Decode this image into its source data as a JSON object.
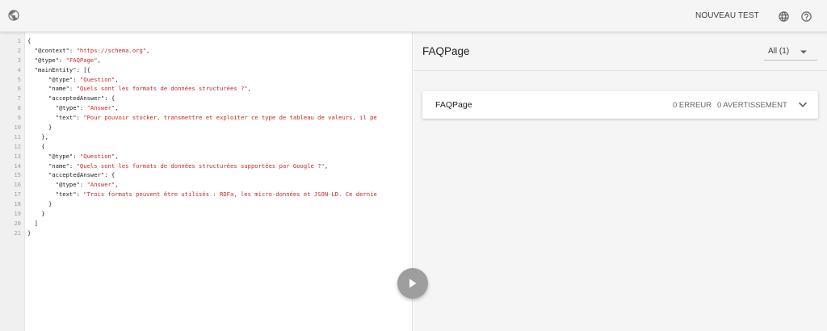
{
  "header": {
    "new_test_label": "NOUVEAU TEST",
    "logo_icon": "globe-icon",
    "language_icon": "globe-language-icon",
    "help_icon": "help-icon"
  },
  "editor": {
    "line_numbers": [
      "1",
      "2",
      "3",
      "4",
      "5",
      "6",
      "7",
      "8",
      "9",
      "10",
      "11",
      "12",
      "13",
      "14",
      "15",
      "16",
      "17",
      "18",
      "19",
      "20",
      "21"
    ],
    "lines": [
      [
        {
          "t": "{",
          "c": "k"
        }
      ],
      [
        {
          "t": "  \"@context\": ",
          "c": "k"
        },
        {
          "t": "\"https://schema.org\"",
          "c": "s"
        },
        {
          "t": ",",
          "c": "k"
        }
      ],
      [
        {
          "t": "  \"@type\": ",
          "c": "k"
        },
        {
          "t": "\"FAQPage\"",
          "c": "s"
        },
        {
          "t": ",",
          "c": "k"
        }
      ],
      [
        {
          "t": "  \"mainEntity\": [{",
          "c": "k"
        }
      ],
      [
        {
          "t": "      \"@type\": ",
          "c": "k"
        },
        {
          "t": "\"Question\"",
          "c": "s"
        },
        {
          "t": ",",
          "c": "k"
        }
      ],
      [
        {
          "t": "      \"name\": ",
          "c": "k"
        },
        {
          "t": "\"Quels sont les formats de données structurées ?\"",
          "c": "s"
        },
        {
          "t": ",",
          "c": "k"
        }
      ],
      [
        {
          "t": "      \"acceptedAnswer\": {",
          "c": "k"
        }
      ],
      [
        {
          "t": "        \"@type\": ",
          "c": "k"
        },
        {
          "t": "\"Answer\"",
          "c": "s"
        },
        {
          "t": ",",
          "c": "k"
        }
      ],
      [
        {
          "t": "        \"text\": ",
          "c": "k"
        },
        {
          "t": "\"Pour pouvoir stocker, transmettre et exploiter ce type de tableau de valeurs, il pe",
          "c": "s"
        }
      ],
      [
        {
          "t": "      }",
          "c": "k"
        }
      ],
      [
        {
          "t": "    },",
          "c": "k"
        }
      ],
      [
        {
          "t": "    {",
          "c": "k"
        }
      ],
      [
        {
          "t": "      \"@type\": ",
          "c": "k"
        },
        {
          "t": "\"Question\"",
          "c": "s"
        },
        {
          "t": ",",
          "c": "k"
        }
      ],
      [
        {
          "t": "      \"name\": ",
          "c": "k"
        },
        {
          "t": "\"Quels sont les formats de données structurées supportées par Google ?\"",
          "c": "s"
        },
        {
          "t": ",",
          "c": "k"
        }
      ],
      [
        {
          "t": "      \"acceptedAnswer\": {",
          "c": "k"
        }
      ],
      [
        {
          "t": "        \"@type\": ",
          "c": "k"
        },
        {
          "t": "\"Answer\"",
          "c": "s"
        },
        {
          "t": ",",
          "c": "k"
        }
      ],
      [
        {
          "t": "        \"text\": ",
          "c": "k"
        },
        {
          "t": "\"Trois formats peuvent être utilisés : RDFa, les micro-données et JSON-LD. Ce dernie",
          "c": "s"
        }
      ],
      [
        {
          "t": "      }",
          "c": "k"
        }
      ],
      [
        {
          "t": "    }",
          "c": "k"
        }
      ],
      [
        {
          "t": "  ]",
          "c": "k"
        }
      ],
      [
        {
          "t": "}",
          "c": "k"
        }
      ]
    ],
    "run_icon": "play-icon"
  },
  "results": {
    "title": "FAQPage",
    "filter": {
      "selected": "All (1)",
      "icon": "dropdown-arrow-icon"
    },
    "items": [
      {
        "title": "FAQPage",
        "errors": "0 ERREUR",
        "warnings": "0 AVERTISSEMENT",
        "icon": "chevron-down-icon"
      }
    ]
  },
  "colors": {
    "string": "#c62828",
    "run_button": "#9e9e9e",
    "header_bg": "#f5f5f5"
  }
}
